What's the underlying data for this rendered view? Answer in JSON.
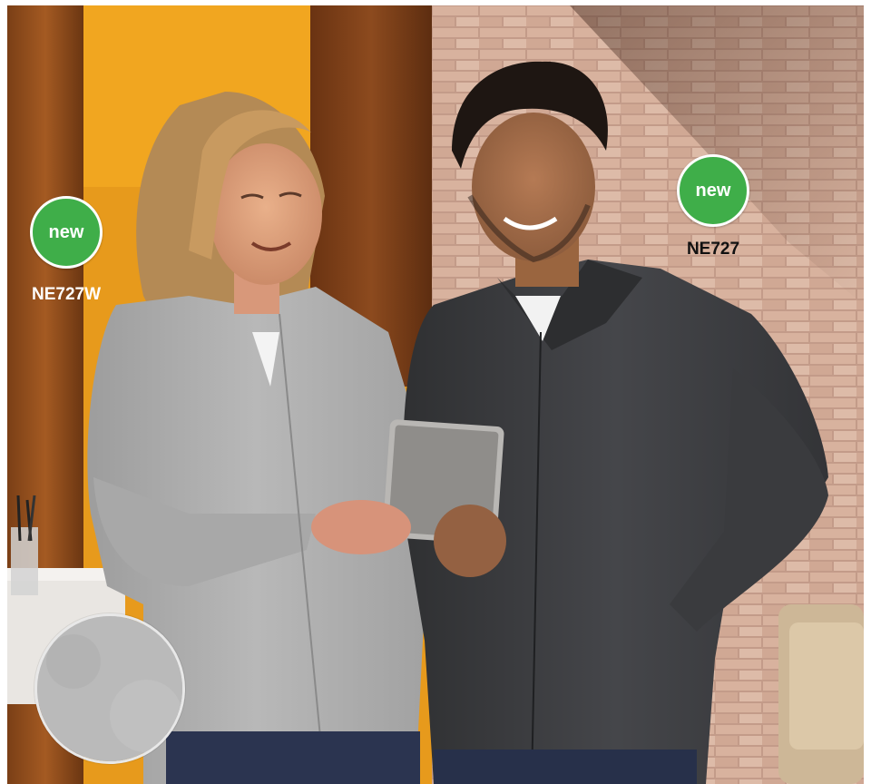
{
  "products": [
    {
      "badge": "new",
      "code": "NE727W",
      "code_color": "#ffffff"
    },
    {
      "badge": "new",
      "code": "NE727",
      "code_color": "#111111"
    }
  ],
  "colors": {
    "badge_green": "#3fae49",
    "wall_orange": "#e79a1c",
    "brick": "#c79a86",
    "grey_jacket": "#a9a9a9",
    "charcoal_jacket": "#3b3c3e"
  }
}
